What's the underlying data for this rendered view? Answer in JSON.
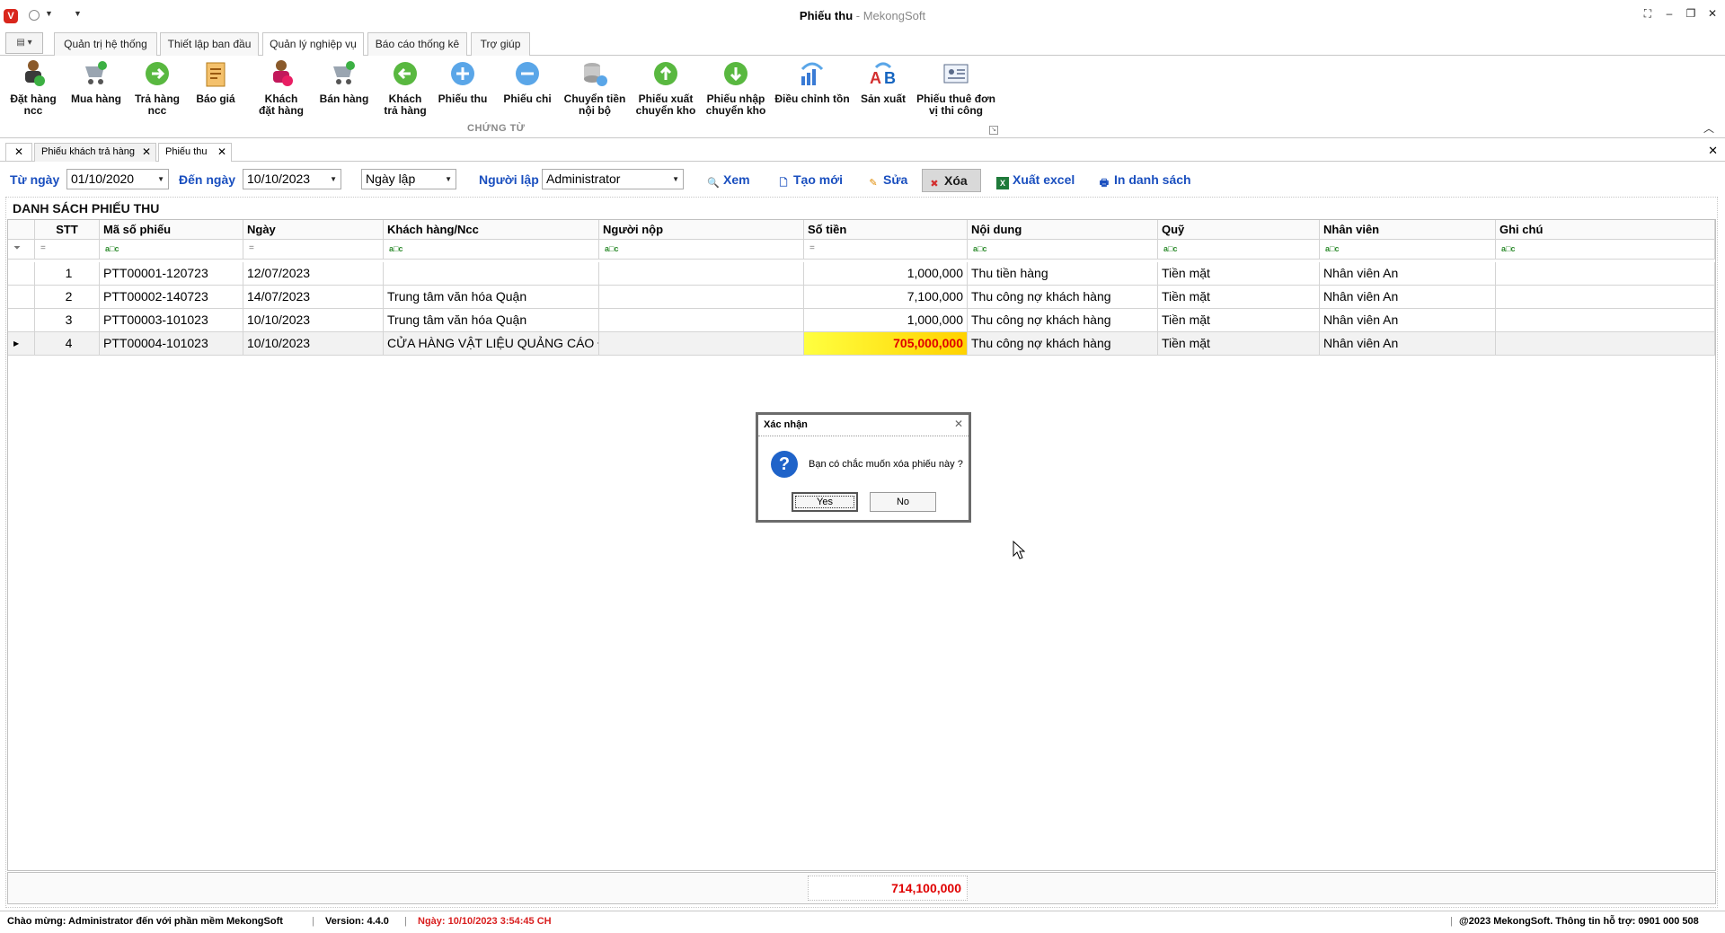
{
  "window": {
    "title": "Phiếu thu",
    "brand": " - MekongSoft",
    "controls": [
      "⛶",
      "–",
      "❐",
      "✕"
    ]
  },
  "ribbon_tabs": [
    {
      "label": "Quản trị hệ thống"
    },
    {
      "label": "Thiết lập ban đầu"
    },
    {
      "label": "Quản lý nghiệp vụ"
    },
    {
      "label": "Báo cáo thống kê"
    },
    {
      "label": "Trợ giúp"
    }
  ],
  "ribbon": {
    "buttons": [
      {
        "l1": "Đặt hàng",
        "l2": "ncc"
      },
      {
        "l1": "Mua hàng",
        "l2": ""
      },
      {
        "l1": "Trả hàng",
        "l2": "ncc"
      },
      {
        "l1": "Báo giá",
        "l2": ""
      },
      {
        "l1": "Khách",
        "l2": "đặt hàng"
      },
      {
        "l1": "Bán hàng",
        "l2": ""
      },
      {
        "l1": "Khách",
        "l2": "trả hàng"
      },
      {
        "l1": "Phiếu thu",
        "l2": ""
      },
      {
        "l1": "Phiếu chi",
        "l2": ""
      },
      {
        "l1": "Chuyển tiền",
        "l2": "nội bộ"
      },
      {
        "l1": "Phiếu xuất",
        "l2": "chuyển kho"
      },
      {
        "l1": "Phiếu nhập",
        "l2": "chuyển kho"
      },
      {
        "l1": "Điều chỉnh tồn",
        "l2": ""
      },
      {
        "l1": "Sản xuất",
        "l2": ""
      },
      {
        "l1": "Phiếu thuê đơn",
        "l2": "vị thi công"
      }
    ],
    "group_label": "CHỨNG TỪ"
  },
  "doc_tabs": [
    {
      "label": "Phiếu khách trả hàng"
    },
    {
      "label": "Phiếu thu"
    }
  ],
  "filters": {
    "from_label": "Từ ngày",
    "from_value": "01/10/2020",
    "to_label": "Đến ngày",
    "to_value": "10/10/2023",
    "date_type": "Ngày lập",
    "creator_label": "Người lập",
    "creator_value": "Administrator"
  },
  "actions": {
    "view": "Xem",
    "create": "Tạo mới",
    "edit": "Sửa",
    "delete": "Xóa",
    "export": "Xuất excel",
    "print": "In danh sách"
  },
  "list_title": "DANH SÁCH PHIẾU THU",
  "columns": [
    "STT",
    "Mã số phiếu",
    "Ngày",
    "Khách hàng/Ncc",
    "Người nộp",
    "Số tiền",
    "Nội dung",
    "Quỹ",
    "Nhân viên",
    "Ghi chú"
  ],
  "filter_symbols": {
    "eq": "=",
    "contains": "a□c"
  },
  "rows": [
    {
      "stt": "1",
      "code": "PTT00001-120723",
      "date": "12/07/2023",
      "customer": "",
      "payer": "",
      "amount": "1,000,000",
      "content": "Thu tiền hàng",
      "fund": "Tiền mặt",
      "staff": "Nhân viên An",
      "note": ""
    },
    {
      "stt": "2",
      "code": "PTT00002-140723",
      "date": "14/07/2023",
      "customer": "Trung tâm văn hóa Quận",
      "payer": "",
      "amount": "7,100,000",
      "content": "Thu công nợ khách hàng",
      "fund": "Tiền mặt",
      "staff": "Nhân viên An",
      "note": ""
    },
    {
      "stt": "3",
      "code": "PTT00003-101023",
      "date": "10/10/2023",
      "customer": "Trung tâm văn hóa Quận",
      "payer": "",
      "amount": "1,000,000",
      "content": "Thu công nợ khách hàng",
      "fund": "Tiền mặt",
      "staff": "Nhân viên An",
      "note": ""
    },
    {
      "stt": "4",
      "code": "PTT00004-101023",
      "date": "10/10/2023",
      "customer": "CỬA HÀNG VẬT LIỆU QUẢNG CÁO Đ...",
      "payer": "",
      "amount": "705,000,000",
      "content": "Thu công nợ khách hàng",
      "fund": "Tiền mặt",
      "staff": "Nhân viên An",
      "note": ""
    }
  ],
  "total": "714,100,000",
  "dialog": {
    "title": "Xác nhận",
    "message": "Bạn có chắc muốn xóa phiếu này ?",
    "yes": "Yes",
    "no": "No"
  },
  "status": {
    "welcome": "Chào mừng: Administrator đến với phần mềm MekongSoft",
    "version": "Version: 4.4.0",
    "date": "Ngày: 10/10/2023 3:54:45 CH",
    "copyright": "@2023 MekongSoft. Thông tin hỗ trợ: 0901 000 508"
  },
  "colors": {
    "accent": "#1a4fbf",
    "highlight_amount": "#e00000",
    "highlight_bg": "#ffff40"
  }
}
